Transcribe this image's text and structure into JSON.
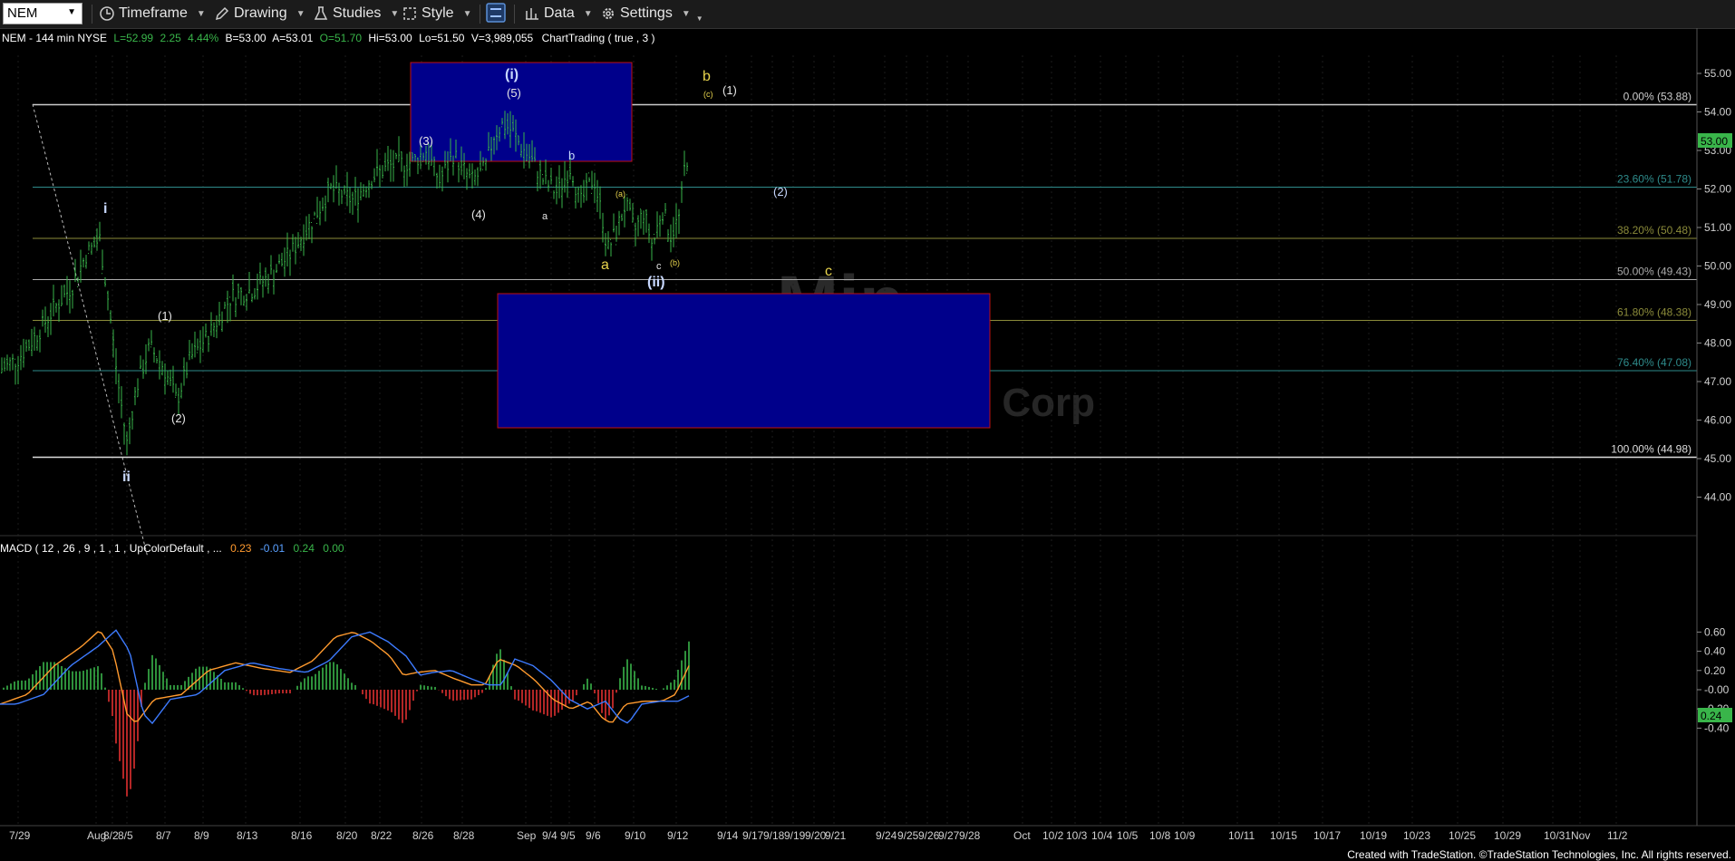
{
  "toolbar": {
    "symbol": "NEM",
    "timeframe": "Timeframe",
    "drawing": "Drawing",
    "studies": "Studies",
    "style": "Style",
    "data": "Data",
    "settings": "Settings"
  },
  "header": {
    "symbol_info": "NEM - 144 min  NYSE",
    "last": "L=52.99",
    "change": "2.25",
    "pct": "4.44%",
    "bid": "B=53.00",
    "ask": "A=53.01",
    "open": "O=51.70",
    "high": "Hi=53.00",
    "low": "Lo=51.50",
    "volume": "V=3,989,055",
    "study": "ChartTrading ( true , 3 )"
  },
  "watermark": {
    "line1": "Min",
    "line2": "Corp"
  },
  "price_axis": {
    "ticks": [
      "55.00",
      "54.00",
      "53.00",
      "52.00",
      "51.00",
      "50.00",
      "49.00",
      "48.00",
      "47.00",
      "46.00",
      "45.00",
      "44.00"
    ],
    "current_price": "53.00"
  },
  "fib_levels": [
    {
      "label": "0.00% (53.88)",
      "color": "#cccccc"
    },
    {
      "label": "23.60% (51.78)",
      "color": "#2e8b8b"
    },
    {
      "label": "38.20% (50.48)",
      "color": "#8b8b3a"
    },
    {
      "label": "50.00% (49.43)",
      "color": "#aaaaaa"
    },
    {
      "label": "61.80% (48.38)",
      "color": "#8b8b3a"
    },
    {
      "label": "76.40% (47.08)",
      "color": "#2e8b8b"
    },
    {
      "label": "100.00% (44.98)",
      "color": "#dddddd"
    }
  ],
  "wave_labels": {
    "i_minor": "i",
    "ii_minor": "ii",
    "w1": "(1)",
    "w2": "(2)",
    "w3": "(3)",
    "w4": "(4)",
    "w5": "(5)",
    "wi": "(i)",
    "wii": "(ii)",
    "b_blue": "b",
    "a_small": "a",
    "a_paren": "(a)",
    "a_yellow": "a",
    "c_small": "c",
    "b_paren": "(b)",
    "c_yellow": "c",
    "b_yellow": "b",
    "c_paren": "(c)",
    "proj_1": "(1)",
    "proj_2": "(2)"
  },
  "macd": {
    "title": "MACD ( 12 , 26 , 9 , 1 , 1 , UpColorDefault , ...",
    "val1": "0.23",
    "val2": "-0.01",
    "val3": "0.24",
    "val4": "0.00",
    "ticks": [
      "0.60",
      "0.40",
      "0.20",
      "-0.00",
      "-0.20",
      "-0.40"
    ],
    "current": "0.24"
  },
  "time_axis": [
    "7/29",
    "Aug",
    "8/2",
    "8/5",
    "8/7",
    "8/9",
    "8/13",
    "8/16",
    "8/20",
    "8/22",
    "8/26",
    "8/28",
    "Sep",
    "9/4",
    "9/5",
    "9/6",
    "9/10",
    "9/12",
    "9/14",
    "9/17",
    "9/18",
    "9/19",
    "9/20",
    "9/21",
    "9/24",
    "9/25",
    "9/26",
    "9/27",
    "9/28",
    "Oct",
    "10/2",
    "10/3",
    "10/4",
    "10/5",
    "10/8",
    "10/9",
    "10/11",
    "10/15",
    "10/17",
    "10/19",
    "10/23",
    "10/25",
    "10/29",
    "10/31",
    "Nov",
    "11/2"
  ],
  "footer": "Created with TradeStation. ©TradeStation Technologies, Inc. All rights reserved.",
  "colors": {
    "up": "#39b54a",
    "down": "#ff3b3b",
    "box": "#00008b",
    "box_border": "#c01010",
    "yellow": "#e8d44d",
    "blue_label": "#c8d8ff"
  }
}
